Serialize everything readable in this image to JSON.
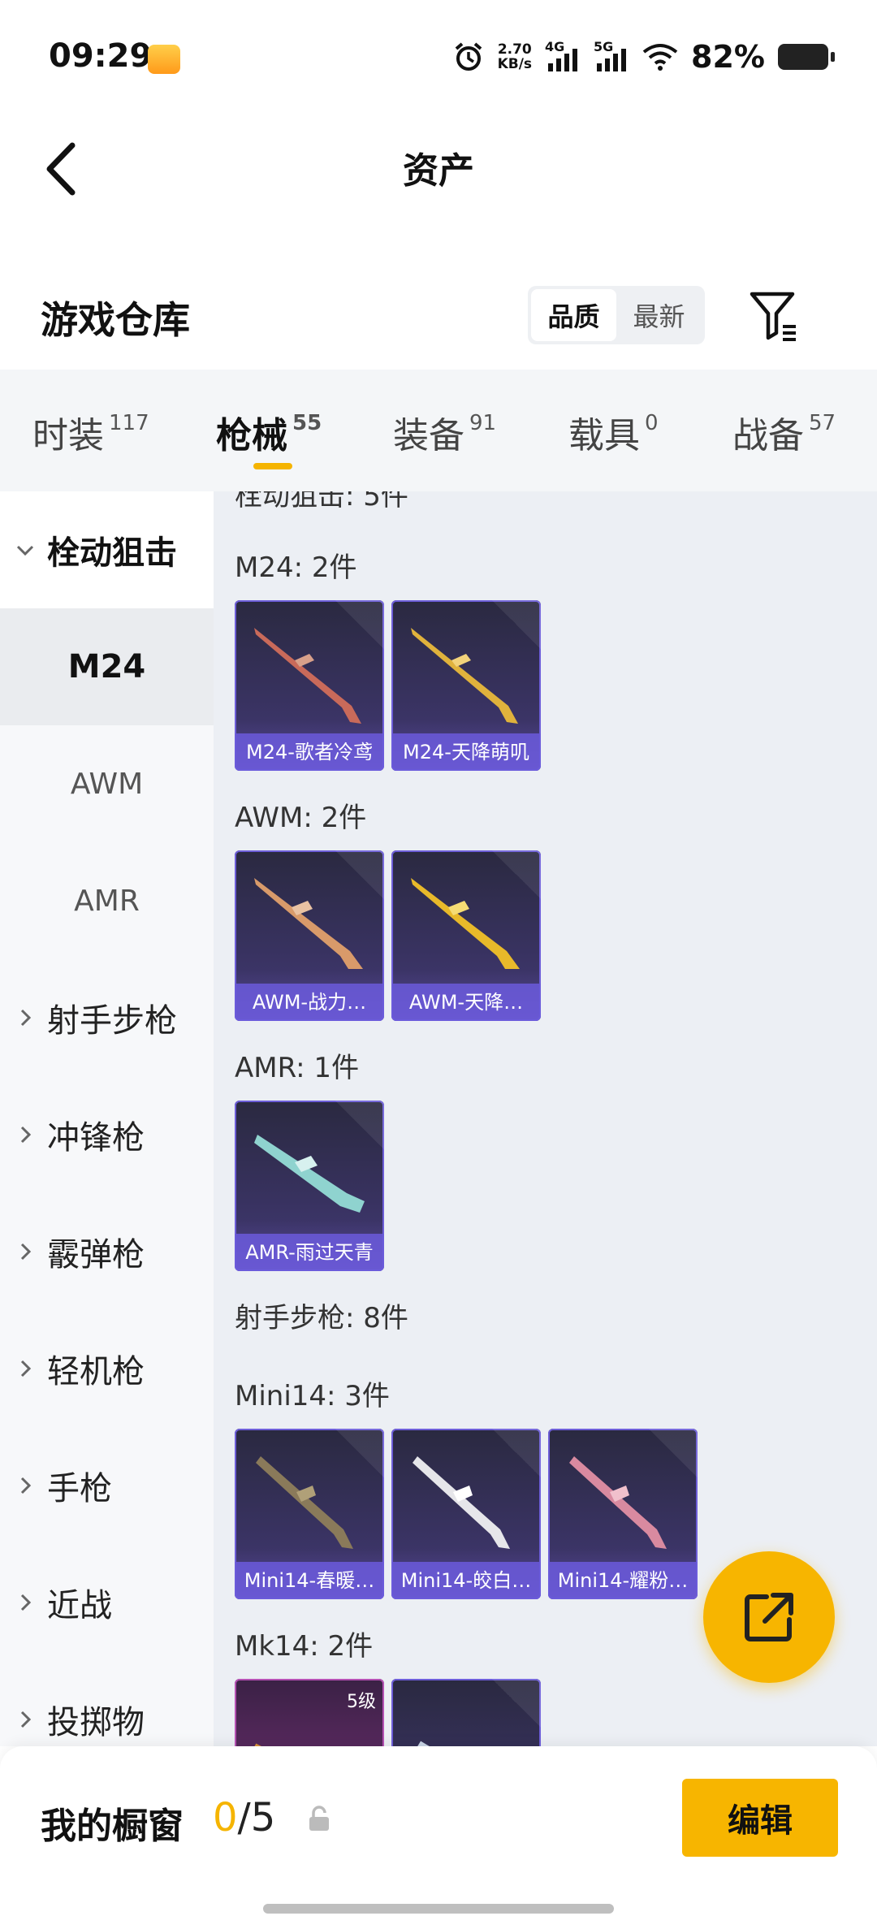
{
  "status_bar": {
    "time": "09:29",
    "speed_value": "2.70",
    "speed_unit": "KB/s",
    "net1": "4G",
    "net2": "5G",
    "battery": "82%"
  },
  "header": {
    "title": "资产"
  },
  "warehouse": {
    "title": "游戏仓库",
    "sort_options": [
      "品质",
      "最新"
    ]
  },
  "tabs": [
    {
      "label": "时装",
      "count": "117"
    },
    {
      "label": "枪械",
      "count": "55"
    },
    {
      "label": "装备",
      "count": "91"
    },
    {
      "label": "载具",
      "count": "0"
    },
    {
      "label": "战备",
      "count": "57"
    }
  ],
  "sidebar": {
    "open_category": "栓动狙击",
    "subitems": [
      "M24",
      "AWM",
      "AMR"
    ],
    "categories": [
      "射手步枪",
      "冲锋枪",
      "霰弹枪",
      "轻机枪",
      "手枪",
      "近战",
      "投掷物"
    ]
  },
  "content": {
    "partial_header": "栓动狙击: 5件",
    "groups": [
      {
        "title": "M24: 2件",
        "items": [
          "M24-歌者冷鸢",
          "M24-天降萌叽"
        ]
      },
      {
        "title": "AWM: 2件",
        "items": [
          "AWM-战力…",
          "AWM-天降…"
        ]
      },
      {
        "title": "AMR: 1件",
        "items": [
          "AMR-雨过天青"
        ]
      },
      {
        "title": "射手步枪: 8件",
        "items": []
      },
      {
        "title": "Mini14: 3件",
        "items": [
          "Mini14-春暖…",
          "Mini14-皎白…",
          "Mini14-耀粉…"
        ]
      },
      {
        "title": "Mk14: 2件",
        "items": [
          "",
          ""
        ],
        "first_level": "5级"
      }
    ]
  },
  "bottom": {
    "title": "我的橱窗",
    "count_current": "0",
    "count_total": "/5",
    "edit_label": "编辑"
  },
  "colors": {
    "accent": "#f7b500"
  }
}
